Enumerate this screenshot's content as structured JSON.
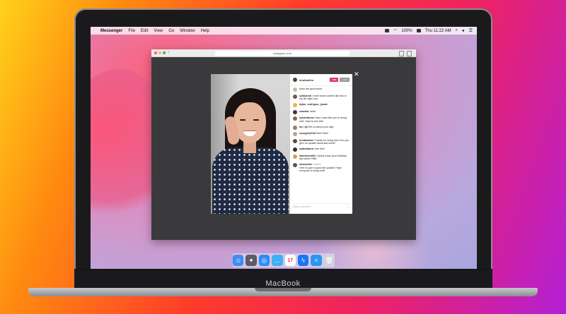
{
  "device": {
    "brand": "MacBook"
  },
  "menubar": {
    "app": "Messenger",
    "items": [
      "File",
      "Edit",
      "View",
      "Go",
      "Window",
      "Help"
    ],
    "battery": "100%",
    "clock": "Thu 11:22 AM"
  },
  "browser": {
    "url": "instagram.com"
  },
  "live": {
    "host": "shuhanlim",
    "live_badge": "LIVE",
    "viewers": "1,104",
    "comments": [
      {
        "user": "",
        "text": "keep the good work!",
        "color": "#c8b8a6"
      },
      {
        "user": "sofiashnti",
        "text": "I need more content like this in my life right now",
        "color": "#6b5a4e"
      },
      {
        "user": "dylan_rodriguez_jorant",
        "text": "",
        "color": "#f0b042"
      },
      {
        "user": "claudiar",
        "text": "hello!",
        "color": "#3a3a3a"
      },
      {
        "user": "kylekebbran",
        "text": "Hey! Looks like you're doing well. Glad to see this!",
        "color": "#7d6c5e"
      },
      {
        "user": "lori_ajl",
        "text": "Tell us about your day!",
        "color": "#9a7c60"
      },
      {
        "user": "cusoghn2018",
        "text": "Nice Filter!",
        "color": "#a8a8a8"
      },
      {
        "user": "bretthawker",
        "text": "Thanks for doing this! Can you give an update about last week?",
        "color": "#5a4a3e"
      },
      {
        "user": "isabelabarrr",
        "text": "love this!",
        "color": "#2f2f2f"
      },
      {
        "user": "danielbremfit",
        "text": "I heard it was your birthday last week! HBD",
        "color": "#d4a056"
      },
      {
        "user": "shuhanlim",
        "text": "Here to give a quick life update! Hope everyone is doing well!",
        "color": "#555555",
        "badge": "Hosted"
      }
    ],
    "comment_placeholder": "Add a comment..."
  },
  "dock": {
    "apps": [
      {
        "name": "finder-icon",
        "glyph": "☺",
        "color": "#3c8ef0"
      },
      {
        "name": "launchpad-icon",
        "glyph": "✦",
        "color": "#5b5b66"
      },
      {
        "name": "safari-icon",
        "glyph": "◎",
        "color": "#2a8df7"
      },
      {
        "name": "messages-icon",
        "glyph": "…",
        "color": "#3fb0f5"
      },
      {
        "name": "calendar-icon",
        "glyph": "17",
        "color": "#ffffff"
      },
      {
        "name": "messenger-icon",
        "glyph": "ϟ",
        "color": "#1877f2"
      },
      {
        "name": "app-store-icon",
        "glyph": "✧",
        "color": "#2a96f3"
      },
      {
        "name": "trash-icon",
        "glyph": "🗑",
        "color": "#d0d3d8"
      }
    ]
  }
}
